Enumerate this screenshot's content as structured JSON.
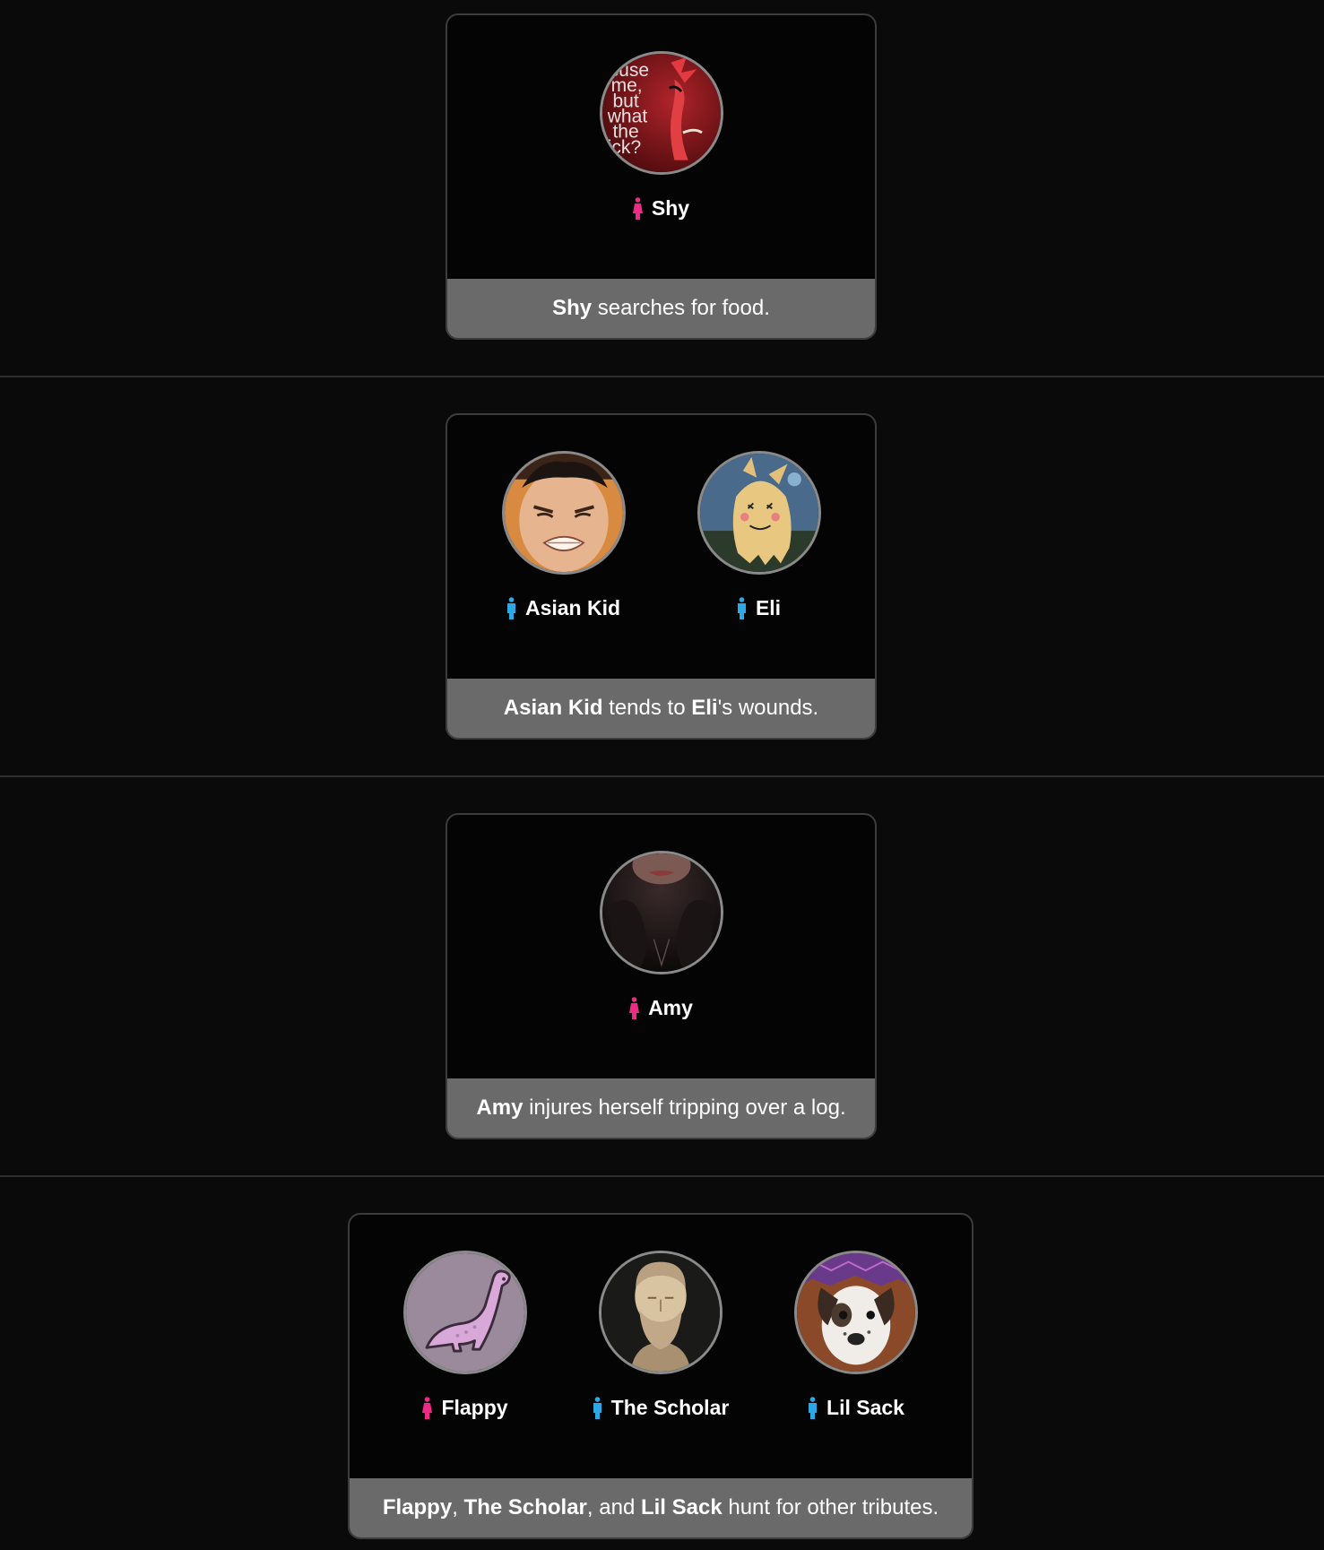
{
  "events": [
    {
      "tributes": [
        {
          "name": "Shy",
          "gender": "female",
          "avatar_icon": "demon-meme-avatar",
          "avatar_text": [
            "cuse",
            "me,",
            "but",
            "what",
            "the",
            "ick?"
          ]
        }
      ],
      "caption": [
        {
          "text": "Shy",
          "bold": true
        },
        {
          "text": " searches for food.",
          "bold": false
        }
      ]
    },
    {
      "tributes": [
        {
          "name": "Asian Kid",
          "gender": "male",
          "avatar_icon": "grimacing-face-avatar"
        },
        {
          "name": "Eli",
          "gender": "male",
          "avatar_icon": "mimikyu-avatar"
        }
      ],
      "caption": [
        {
          "text": "Asian Kid",
          "bold": true
        },
        {
          "text": " tends to ",
          "bold": false
        },
        {
          "text": "Eli",
          "bold": true
        },
        {
          "text": "'s wounds.",
          "bold": false
        }
      ]
    },
    {
      "tributes": [
        {
          "name": "Amy",
          "gender": "female",
          "avatar_icon": "dark-portrait-avatar"
        }
      ],
      "caption": [
        {
          "text": "Amy",
          "bold": true
        },
        {
          "text": " injures herself tripping over a log.",
          "bold": false
        }
      ]
    },
    {
      "tributes": [
        {
          "name": "Flappy",
          "gender": "female",
          "avatar_icon": "pink-dinosaur-avatar"
        },
        {
          "name": "The Scholar",
          "gender": "male",
          "avatar_icon": "bust-statue-avatar"
        },
        {
          "name": "Lil Sack",
          "gender": "male",
          "avatar_icon": "dog-avatar"
        }
      ],
      "caption": [
        {
          "text": "Flappy",
          "bold": true
        },
        {
          "text": ", ",
          "bold": false
        },
        {
          "text": "The Scholar",
          "bold": true
        },
        {
          "text": ", and ",
          "bold": false
        },
        {
          "text": "Lil Sack",
          "bold": true
        },
        {
          "text": " hunt for other tributes.",
          "bold": false
        }
      ]
    }
  ],
  "colors": {
    "page_background": "#0a0a0a",
    "card_background": "#040404",
    "caption_background": "#6a6a6a",
    "female_icon": "#ee2a86",
    "male_icon": "#2aa9e4",
    "avatar_border": "#8a8a8a"
  }
}
